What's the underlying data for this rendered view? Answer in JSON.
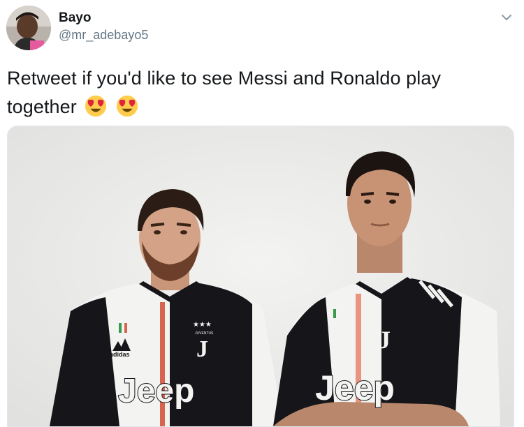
{
  "author": {
    "name": "Bayo",
    "handle": "@mr_adebayo5",
    "avatar_icon": "profile-photo"
  },
  "tweet": {
    "text_line1": "Retweet if you'd like to see Messi and Ronaldo play",
    "text_line2": "together",
    "emojis": [
      "heart-eyes-emoji",
      "heart-eyes-emoji"
    ]
  },
  "menu": {
    "icon": "chevron-down-icon"
  },
  "media": {
    "description_icon": "photo",
    "jersey_sponsor": "Jeep",
    "jersey_brand": "adidas",
    "jersey_team": "JUVENTUS",
    "colors": {
      "jersey_black": "#16161a",
      "jersey_white": "#f4f4f2",
      "stripe_red": "#d8644f",
      "jersey_stripe_pink": "#e99480"
    }
  }
}
